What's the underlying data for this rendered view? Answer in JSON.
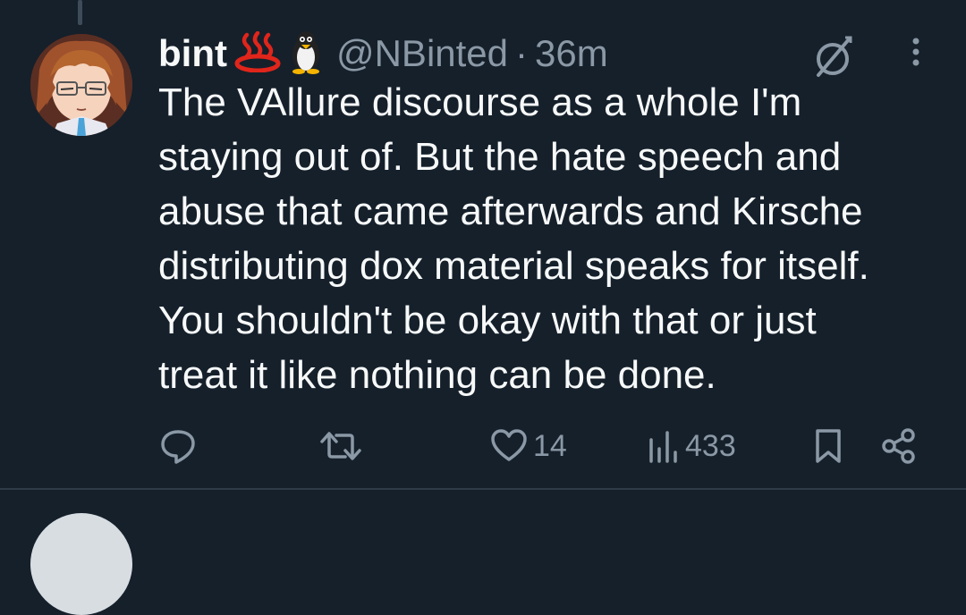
{
  "tweet": {
    "display_name": "bint",
    "emoji_1": "hot-springs-icon",
    "emoji_2": "penguin-icon",
    "handle": "@NBinted",
    "separator": "·",
    "time": "36m",
    "text": "The VAllure discourse as a whole I'm\nstaying out of. But the hate speech and\nabuse that came afterwards and Kirsche\ndistributing dox material speaks for itself.\nYou shouldn't be okay with that or just\ntreat it like nothing can be done.",
    "actions": {
      "reply_icon": "reply-icon",
      "retweet_icon": "retweet-icon",
      "like_icon": "heart-icon",
      "like_count": "14",
      "views_icon": "views-icon",
      "views_count": "433",
      "bookmark_icon": "bookmark-icon",
      "share_icon": "share-icon"
    },
    "header_icons": {
      "grok": "grok-icon",
      "more": "more-icon"
    }
  },
  "colors": {
    "background": "#15202b",
    "primary_text": "#f7f9f9",
    "secondary_text": "#8b98a5",
    "divider": "#2f3b47",
    "hot_springs": "#e0251b"
  }
}
